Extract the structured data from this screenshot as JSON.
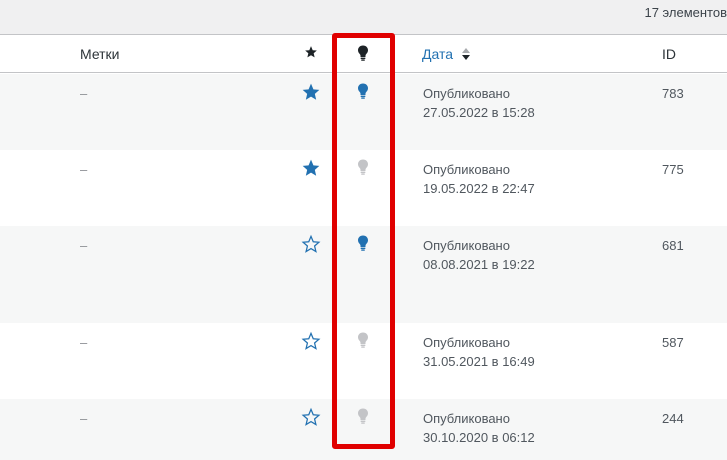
{
  "list": {
    "items_count": "17 элементов"
  },
  "table": {
    "headers": {
      "tags": "Метки",
      "date": "Дата",
      "id": "ID"
    },
    "rows": [
      {
        "tags": "–",
        "featured": true,
        "bulb_active": true,
        "status": "Опубликовано",
        "datetime": "27.05.2022 в 15:28",
        "id": "783"
      },
      {
        "tags": "–",
        "featured": true,
        "bulb_active": false,
        "status": "Опубликовано",
        "datetime": "19.05.2022 в 22:47",
        "id": "775"
      },
      {
        "tags": "–",
        "featured": false,
        "bulb_active": true,
        "status": "Опубликовано",
        "datetime": "08.08.2021 в 19:22",
        "id": "681"
      },
      {
        "tags": "–",
        "featured": false,
        "bulb_active": false,
        "status": "Опубликовано",
        "datetime": "31.05.2021 в 16:49",
        "id": "587"
      },
      {
        "tags": "–",
        "featured": false,
        "bulb_active": false,
        "status": "Опубликовано",
        "datetime": "30.10.2020 в 06:12",
        "id": "244"
      }
    ]
  },
  "colors": {
    "accent": "#2271b1",
    "icon_inactive": "#c3c4c7",
    "highlight_frame": "#e00000"
  },
  "icons": {
    "featured_on": "star-filled-icon",
    "featured_off": "star-outline-icon",
    "bulb": "lightbulb-icon",
    "sort": "sort-arrows-icon"
  }
}
